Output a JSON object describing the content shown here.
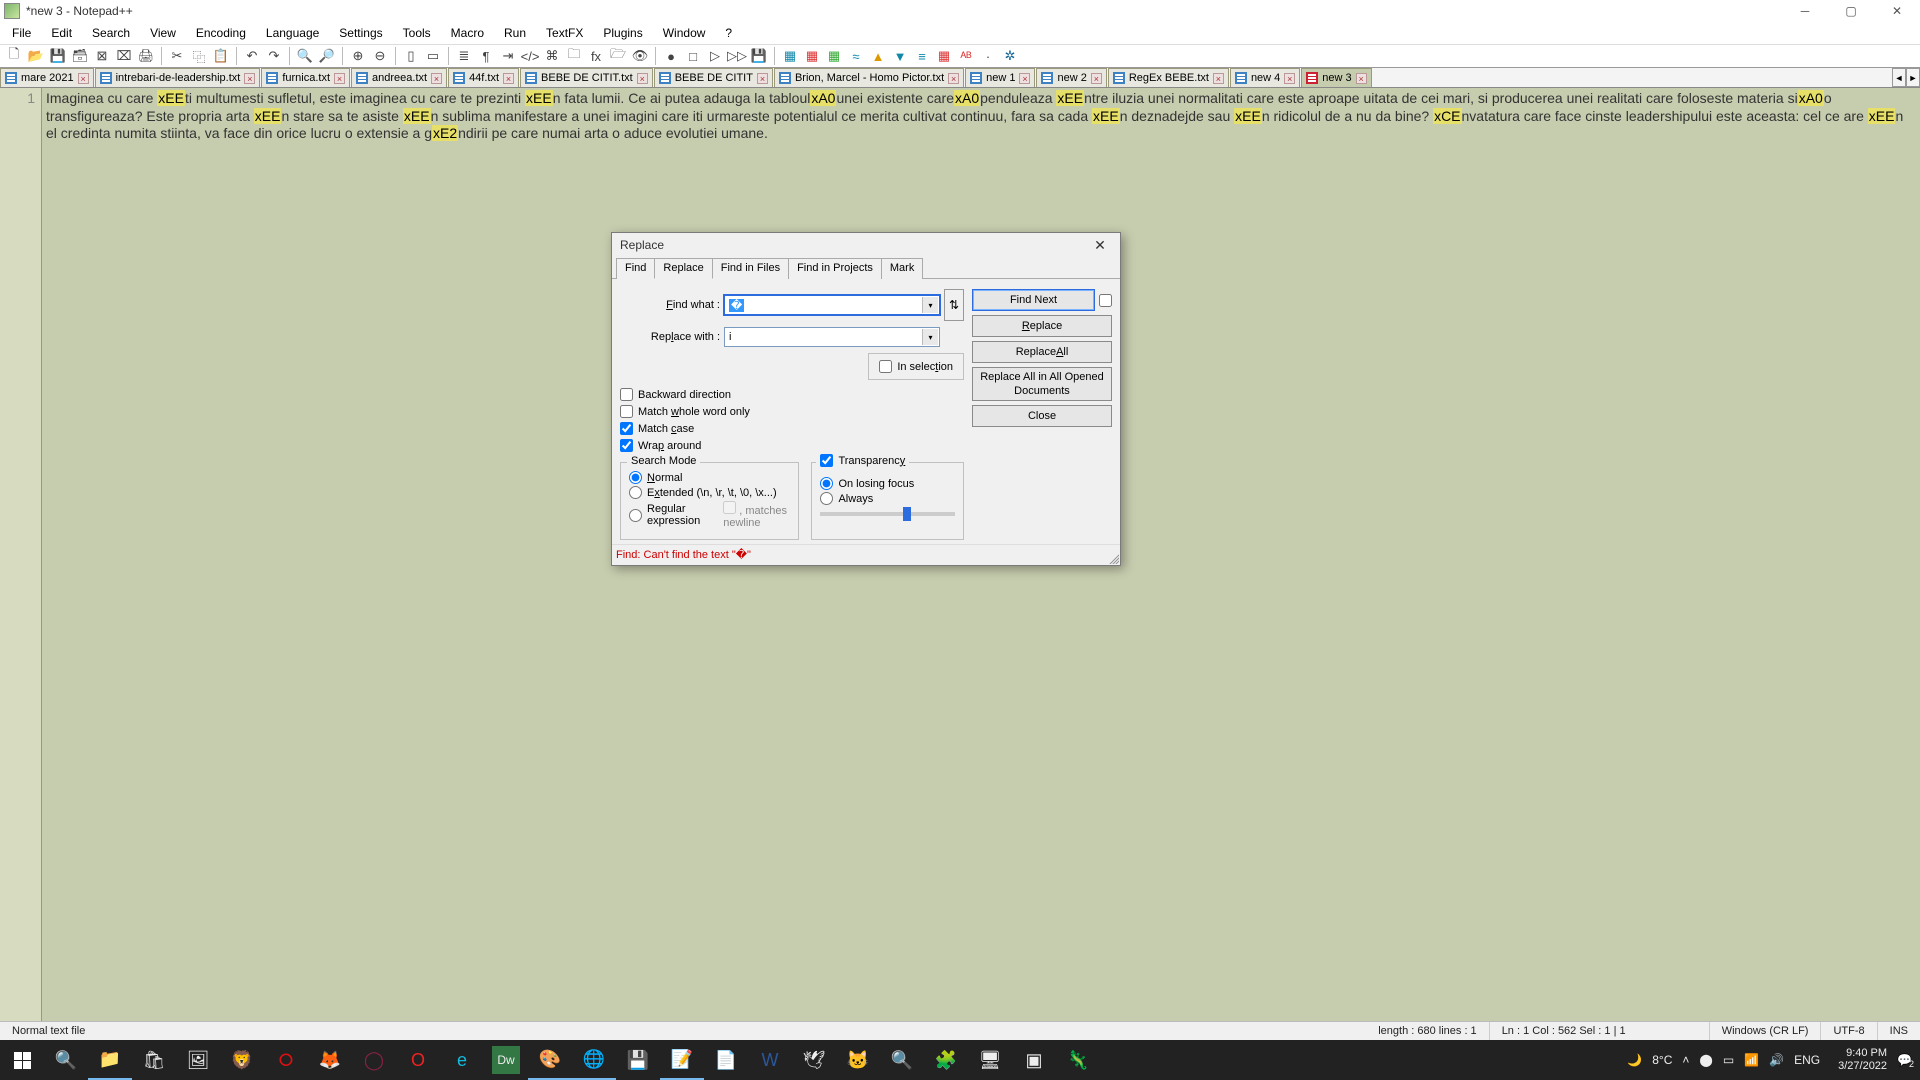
{
  "window": {
    "title": "*new 3 - Notepad++"
  },
  "menu": [
    "File",
    "Edit",
    "Search",
    "View",
    "Encoding",
    "Language",
    "Settings",
    "Tools",
    "Macro",
    "Run",
    "TextFX",
    "Plugins",
    "Window",
    "?"
  ],
  "tabs": [
    {
      "label": "mare 2021",
      "active": false
    },
    {
      "label": "intrebari-de-leadership.txt",
      "active": false
    },
    {
      "label": "furnica.txt",
      "active": false
    },
    {
      "label": "andreea.txt",
      "active": false
    },
    {
      "label": "44f.txt",
      "active": false
    },
    {
      "label": "BEBE DE CITIT.txt",
      "active": false
    },
    {
      "label": "BEBE DE CITIT",
      "active": false
    },
    {
      "label": "Brion, Marcel - Homo Pictor.txt",
      "active": false
    },
    {
      "label": "new 1",
      "active": false
    },
    {
      "label": "new 2",
      "active": false
    },
    {
      "label": "RegEx BEBE.txt",
      "active": false
    },
    {
      "label": "new 4",
      "active": false
    },
    {
      "label": "new 3",
      "active": true
    }
  ],
  "editor": {
    "line_number": "1",
    "segments": [
      {
        "t": "Imaginea cu care "
      },
      {
        "h": "xEE"
      },
      {
        "t": "ti multumesti sufletul, este imaginea cu care te prezinti "
      },
      {
        "h": "xEE"
      },
      {
        "t": "n fata lumii. Ce ai putea adauga la tabloul"
      },
      {
        "h": "xA0"
      },
      {
        "t": "unei existente care"
      },
      {
        "h": "xA0"
      },
      {
        "t": "penduleaza "
      },
      {
        "h": "xEE"
      },
      {
        "t": "ntre iluzia unei normalitati care este aproape uitata de cei mari, si producerea unei realitati care foloseste materia si"
      },
      {
        "h": "xA0"
      },
      {
        "t": "o transfigureaza? Este propria arta "
      },
      {
        "h": "xEE"
      },
      {
        "t": "n stare sa te asiste "
      },
      {
        "h": "xEE"
      },
      {
        "t": "n sublima manifestare a unei imagini care iti urmareste potentialul ce merita cultivat continuu, fara sa cada "
      },
      {
        "h": "xEE"
      },
      {
        "t": "n deznadejde sau "
      },
      {
        "h": "xEE"
      },
      {
        "t": "n ridicolul de a nu da bine? "
      },
      {
        "h": "xCE"
      },
      {
        "t": "nvatatura care face cinste leadershipului este aceasta: cel ce are "
      },
      {
        "h": "xEE"
      },
      {
        "t": "n el credinta numita stiinta, va face din orice lucru o extensie a g"
      },
      {
        "h": "xE2"
      },
      {
        "t": "ndirii pe care numai arta o aduce evolutiei umane."
      }
    ]
  },
  "dialog": {
    "title": "Replace",
    "tabs": [
      "Find",
      "Replace",
      "Find in Files",
      "Find in Projects",
      "Mark"
    ],
    "active_tab": 1,
    "find_label": "Find what :",
    "find_value": "�",
    "replace_label": "Replace with :",
    "replace_value": "i",
    "buttons": {
      "find_next": "Find Next",
      "replace": "Replace",
      "replace_all": "Replace All",
      "replace_all_docs": "Replace All in All Opened Documents",
      "close": "Close"
    },
    "in_selection": "In selection",
    "checks": {
      "backward": "Backward direction",
      "whole_word": "Match whole word only",
      "match_case": "Match case",
      "wrap": "Wrap around"
    },
    "mode_title": "Search Mode",
    "modes": {
      "normal": "Normal",
      "extended": "Extended (\\n, \\r, \\t, \\0, \\x...)",
      "regex": "Regular expression",
      "newline": ", matches newline"
    },
    "transparency": {
      "label": "Transparency",
      "on_focus": "On losing focus",
      "always": "Always"
    },
    "status": "Find: Can't find the text \"�\""
  },
  "statusbar": {
    "left": "Normal text file",
    "length": "length : 680    lines : 1",
    "pos": "Ln : 1    Col : 562    Sel : 1 | 1",
    "eol": "Windows (CR LF)",
    "enc": "UTF-8",
    "ins": "INS"
  },
  "taskbar": {
    "weather": "8°C",
    "lang": "ENG",
    "time": "9:40 PM",
    "date": "3/27/2022",
    "notif": "2"
  }
}
